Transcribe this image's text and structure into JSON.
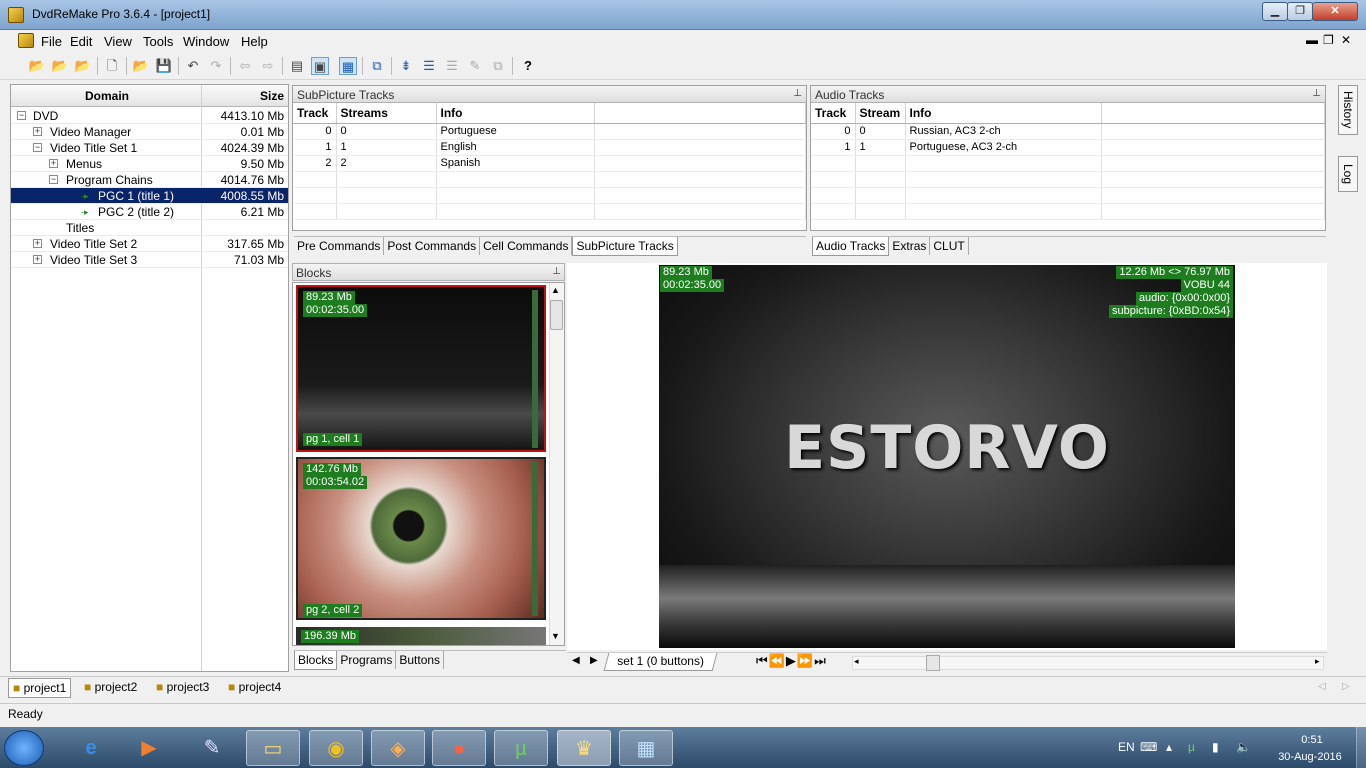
{
  "window": {
    "title": "DvdReMake Pro 3.6.4 - [project1]"
  },
  "menu": [
    "File",
    "Edit",
    "View",
    "Tools",
    "Window",
    "Help"
  ],
  "tree": {
    "col_domain": "Domain",
    "col_size": "Size",
    "rows": [
      {
        "label": "DVD",
        "size": "4413.10 Mb"
      },
      {
        "label": "Video Manager",
        "size": "0.01 Mb"
      },
      {
        "label": "Video Title Set 1",
        "size": "4024.39 Mb"
      },
      {
        "label": "Menus",
        "size": "9.50 Mb"
      },
      {
        "label": "Program Chains",
        "size": "4014.76 Mb"
      },
      {
        "label": "PGC 1  (title 1)",
        "size": "4008.55 Mb"
      },
      {
        "label": "PGC 2  (title 2)",
        "size": "6.21 Mb"
      },
      {
        "label": "Titles",
        "size": ""
      },
      {
        "label": "Video Title Set 2",
        "size": "317.65 Mb"
      },
      {
        "label": "Video Title Set 3",
        "size": "71.03 Mb"
      }
    ]
  },
  "subpicture": {
    "title": "SubPicture Tracks",
    "cols": [
      "Track",
      "Streams",
      "Info"
    ],
    "rows": [
      [
        "0",
        "0",
        "Portuguese"
      ],
      [
        "1",
        "1",
        "English"
      ],
      [
        "2",
        "2",
        "Spanish"
      ]
    ],
    "tabs": [
      "Pre Commands",
      "Post Commands",
      "Cell Commands",
      "SubPicture Tracks"
    ]
  },
  "audio": {
    "title": "Audio Tracks",
    "cols": [
      "Track",
      "Stream",
      "Info"
    ],
    "rows": [
      [
        "0",
        "0",
        "Russian,  AC3 2-ch"
      ],
      [
        "1",
        "1",
        "Portuguese,  AC3 2-ch"
      ]
    ],
    "tabs": [
      "Audio Tracks",
      "Extras",
      "CLUT"
    ]
  },
  "blocks": {
    "title": "Blocks",
    "items": [
      {
        "size": "89.23 Mb",
        "time": "00:02:35.00",
        "cell": "pg 1, cell 1"
      },
      {
        "size": "142.76 Mb",
        "time": "00:03:54.02",
        "cell": "pg 2, cell 2"
      },
      {
        "size": "196.39 Mb",
        "time": "",
        "cell": ""
      }
    ],
    "tabs": [
      "Blocks",
      "Programs",
      "Buttons"
    ]
  },
  "viewer": {
    "size": "89.23 Mb",
    "time": "00:02:35.00",
    "right1": "12.26 Mb <> 76.97 Mb",
    "right2": "VOBU 44",
    "right3": "audio: {0x00:0x00}",
    "right4": "subpicture: {0xBD:0x54}",
    "caption": "ESTORVO",
    "set_tab": "set 1 (0 buttons)"
  },
  "side_tabs": [
    "History",
    "Log"
  ],
  "projects": [
    "project1",
    "project2",
    "project3",
    "project4"
  ],
  "status": "Ready",
  "tray": {
    "lang": "EN",
    "time": "0:51",
    "date": "30-Aug-2016"
  }
}
